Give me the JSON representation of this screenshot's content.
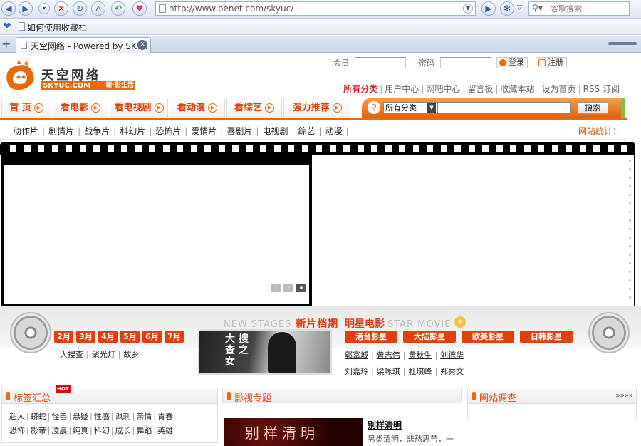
{
  "browser": {
    "url": "http://www.benet.com/skyuc/",
    "search_placeholder": "谷歌搜索",
    "favorites_item": "如何使用收藏栏",
    "tab_title": "天空网络 - Powered by SKY...",
    "icons": [
      "back-icon",
      "forward-icon",
      "dropdown-icon",
      "stop-icon",
      "refresh-icon",
      "home-icon",
      "undo-icon",
      "favorite-icon",
      "go-icon",
      "settings-icon",
      "search-icon"
    ]
  },
  "site": {
    "logo_cn": "天空网络",
    "logo_en": "SKYUC.COM",
    "slogan": "新·影生活",
    "member_label": "会员",
    "password_label": "密码",
    "login_label": "登录",
    "register_label": "注册",
    "top_links": [
      "所有分类",
      "用户中心",
      "网吧中心",
      "留言板",
      "收藏本站",
      "设为首页",
      "RSS 订阅"
    ],
    "nav_tabs": [
      "首 页",
      "看电影",
      "看电视剧",
      "看动漫",
      "看综艺",
      "强力推荐"
    ],
    "search_category": "所有分类",
    "search_button": "搜索",
    "sub_nav": [
      "动作片",
      "剧情片",
      "战争片",
      "科幻片",
      "恐怖片",
      "爱情片",
      "喜剧片",
      "电视剧",
      "综艺",
      "动漫"
    ],
    "stats_label": "网站统计："
  },
  "banner": {
    "pager": [
      "‹",
      "›",
      "▪"
    ]
  },
  "new_stages": {
    "heading_en": "NEW STAGES",
    "heading_cn": "新片档期",
    "months": [
      "2月",
      "3月",
      "4月",
      "5月",
      "6月",
      "7月"
    ],
    "links": [
      "大搜查",
      "聚光灯",
      "故乡"
    ],
    "poster_text": "大 搜 查 之 女"
  },
  "star_movie": {
    "heading_cn": "明星电影",
    "heading_en": "STAR MOVIE",
    "regions": [
      "港台影星",
      "大陆影星",
      "欧美影星",
      "日韩影星"
    ],
    "links_row1": [
      "郭富城",
      "曾志伟",
      "黄秋生",
      "刘德华"
    ],
    "links_row2": [
      "刘嘉玲",
      "梁咏琪",
      "杜琪峰",
      "郑秀文"
    ]
  },
  "tags_panel": {
    "title": "标签汇总",
    "hot": "HOT",
    "rows": [
      [
        "超人",
        "蟒蛇",
        "怪兽",
        "悬疑",
        "性感",
        "讽刺",
        "亲情",
        "青春"
      ],
      [
        "恐怖",
        "影帝",
        "凌晨",
        "纯真",
        "科幻",
        "成长",
        "舞蹈",
        "英雄"
      ]
    ]
  },
  "topic_panel": {
    "title": "影视专题",
    "image_text": "别样清明",
    "item_title": "别样清明",
    "item_desc": "另类清明，悲愁思苦，一"
  },
  "survey_panel": {
    "title": "网站调查",
    "more": "»»»»"
  }
}
